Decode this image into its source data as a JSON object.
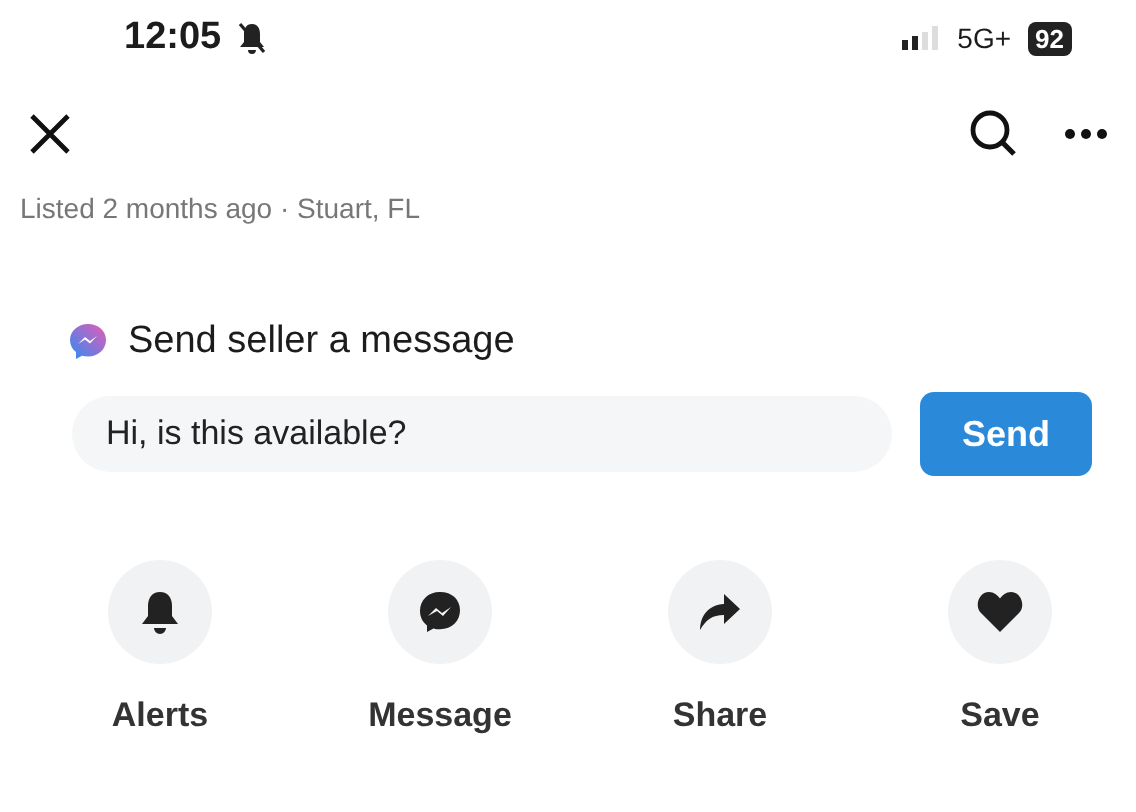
{
  "status_bar": {
    "time": "12:05",
    "network": "5G+",
    "battery": "92"
  },
  "listing": {
    "meta": "Listed 2 months ago · Stuart, FL"
  },
  "message": {
    "title": "Send seller a message",
    "value": "Hi, is this available?",
    "button": "Send"
  },
  "actions": [
    {
      "kind": "alerts",
      "label": "Alerts"
    },
    {
      "kind": "message",
      "label": "Message"
    },
    {
      "kind": "share",
      "label": "Share"
    },
    {
      "kind": "save",
      "label": "Save"
    }
  ]
}
